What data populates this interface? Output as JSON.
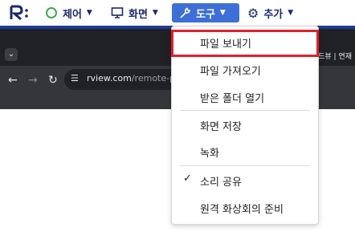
{
  "app": {
    "logo": "R:"
  },
  "topbar": {
    "menus": [
      {
        "label": "제어",
        "icon": "circle-icon"
      },
      {
        "label": "화면",
        "icon": "monitor-icon"
      },
      {
        "label": "도구",
        "icon": "wrench-icon",
        "active": true
      },
      {
        "label": "추가",
        "icon": "gear-icon"
      }
    ]
  },
  "browser": {
    "right_text": "드뷰 | 연재",
    "url_host": "rview.com",
    "url_path": "/remote-pc"
  },
  "dropdown": {
    "items": [
      {
        "label": "파일 보내기",
        "highlighted": true
      },
      {
        "label": "파일 가져오기"
      },
      {
        "label": "받은 폴더 열기"
      },
      {
        "label": "화면 저장"
      },
      {
        "label": "녹화"
      },
      {
        "label": "소리 공유",
        "checked": true
      },
      {
        "label": "원격 화상회의 준비"
      }
    ],
    "check_glyph": "✓"
  },
  "colors": {
    "accent": "#3d6fd6",
    "nav_text": "#1b2a6b",
    "highlight_border": "#e0202c"
  }
}
